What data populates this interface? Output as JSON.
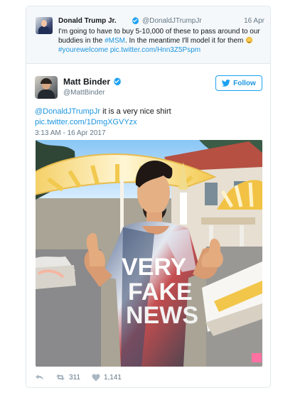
{
  "quoted_tweet": {
    "author_name": "Donald Trump Jr.",
    "author_handle": "@DonaldJTrumpJr",
    "date": "16 Apr",
    "text_part_1": "I'm going to have to buy 5-10,000 of these to pass around to our buddies in the ",
    "hashtag_1": "#MSM",
    "text_part_2": ". In the meantime I'll model it for them ",
    "hashtag_2": "#yourewelcome",
    "link": "pic.twitter.com/Hnn3Z5Pspm"
  },
  "main_tweet": {
    "author_name": "Matt Binder",
    "author_handle": "@MattBinder",
    "follow_label": "Follow",
    "mention": "@DonaldJTrumpJr",
    "text": " it is a very nice shirt",
    "link": "pic.twitter.com/1DmgXGVYzx",
    "timestamp": "3:13 AM - 16 Apr 2017",
    "shirt_lines": [
      "VERY",
      "FAKE",
      "NEWS"
    ]
  },
  "actions": {
    "retweet_count": "311",
    "like_count": "1,141"
  },
  "colors": {
    "accent": "#1b95e0",
    "border": "#e1e8ed",
    "muted": "#657786",
    "text": "#14171a"
  },
  "icons": {
    "reply": "reply-icon",
    "retweet": "retweet-icon",
    "like": "heart-icon",
    "verified": "verified-badge-icon",
    "follow": "twitter-bird-icon"
  }
}
